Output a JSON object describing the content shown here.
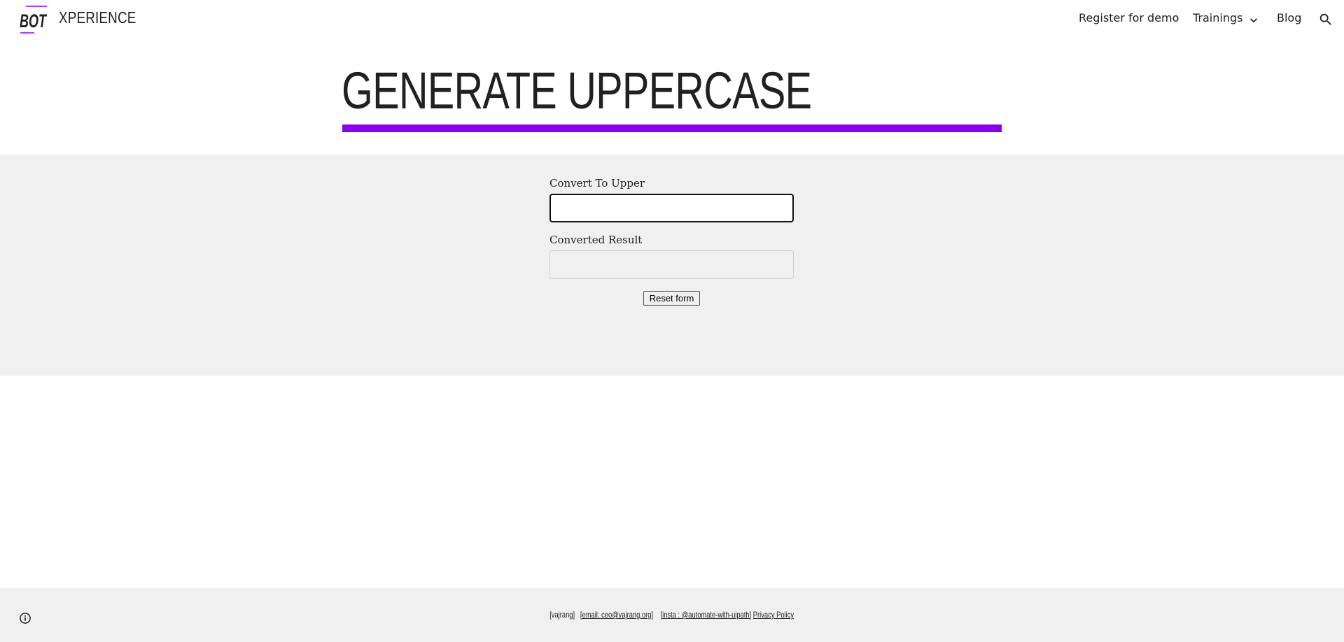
{
  "header": {
    "logo_text": "BOT",
    "site_title": "XPERIENCE",
    "nav": {
      "register": "Register for demo",
      "trainings": "Trainings",
      "blog": "Blog"
    },
    "icons": {
      "trainings_dropdown": "chevron-down-icon",
      "search": "search-icon"
    }
  },
  "page": {
    "title": "GENERATE UPPERCASE",
    "accent_color": "#8b00f0"
  },
  "form": {
    "input_label": "Convert To Upper",
    "input_value": "",
    "result_label": "Converted Result",
    "result_value": "",
    "reset_label": "Reset form"
  },
  "footer": {
    "name": "[vajrang]",
    "email": "[email: ceo@vajrang.org]",
    "insta": "[insta : @automate-with-uipath]",
    "privacy": "Privacy Policy",
    "info_icon": "info-icon"
  }
}
